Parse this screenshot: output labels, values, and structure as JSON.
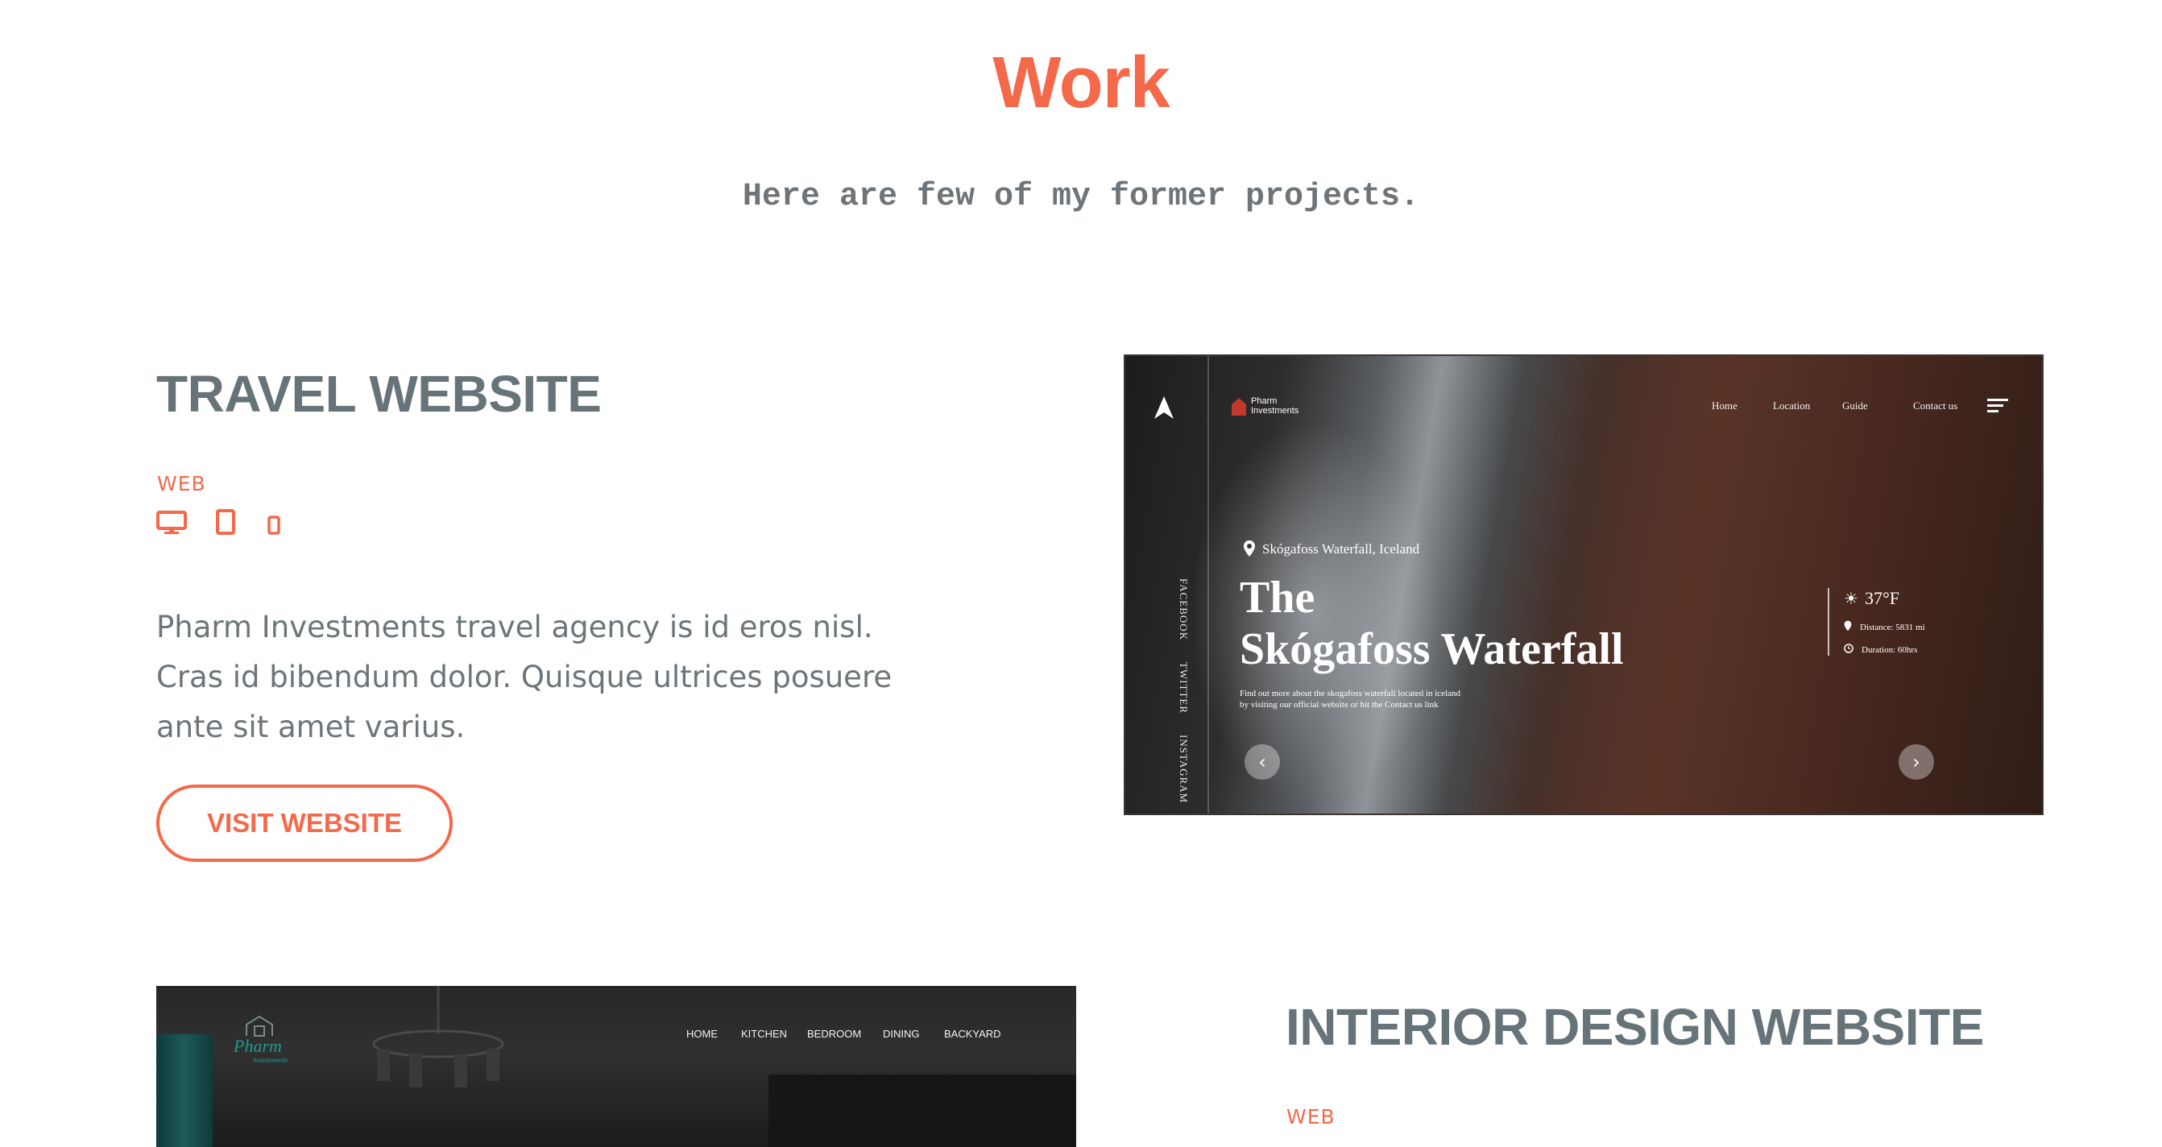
{
  "section": {
    "title": "Work",
    "subtitle": "Here are few of my former projects."
  },
  "projects": [
    {
      "title": "TRAVEL WEBSITE",
      "tag": "WEB",
      "devices": [
        "desktop-icon",
        "tablet-icon",
        "mobile-icon"
      ],
      "description_lines": [
        "Pharm Investments travel agency is id eros nisl.",
        "Cras id bibendum dolor. Quisque ultrices posuere",
        "ante sit amet varius."
      ],
      "button_label": "VISIT WEBSITE",
      "preview": {
        "brand_line1": "Pharm",
        "brand_line2": "Investments",
        "nav": [
          "Home",
          "Location",
          "Guide",
          "Contact us"
        ],
        "social": [
          "FACEBOOK",
          "TWITTER",
          "INSTAGRAM"
        ],
        "location": "Skógafoss Waterfall, Iceland",
        "heading_line1": "The",
        "heading_line2": "Skógafoss Waterfall",
        "blurb_line1": "Find out more about the skogafoss waterfall located in iceland",
        "blurb_line2": "by visiting our official website or hit the Contact us link",
        "temperature": "37°F",
        "distance": "Distance: 5831 mi",
        "duration": "Duration: 60hrs"
      }
    },
    {
      "title": "INTERIOR DESIGN WEBSITE",
      "tag": "WEB",
      "preview": {
        "logo_text": "Pharm",
        "logo_sub": "Investments",
        "nav": [
          "HOME",
          "KITCHEN",
          "BEDROOM",
          "DINING",
          "BACKYARD"
        ]
      }
    }
  ],
  "colors": {
    "accent": "#f4694a",
    "title_gray": "#667479",
    "text_gray": "#6c7579"
  }
}
